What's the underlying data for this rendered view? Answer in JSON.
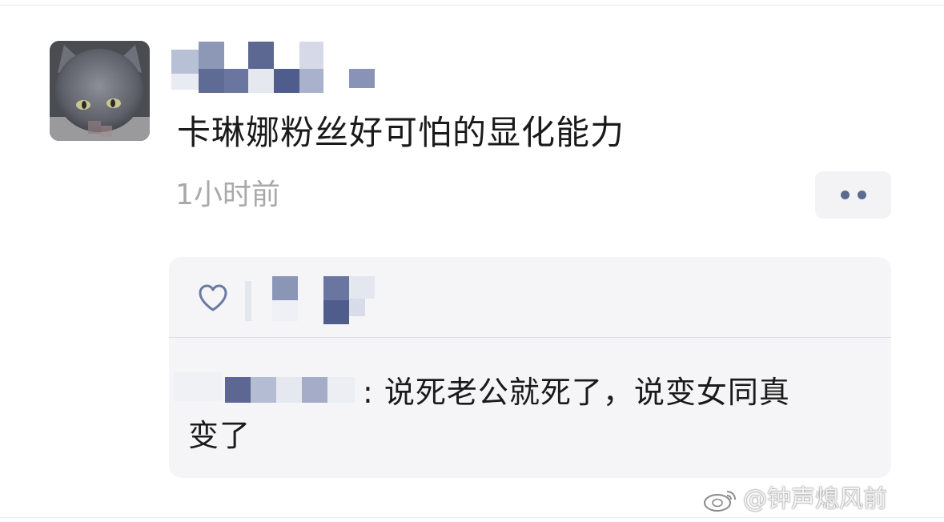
{
  "post": {
    "text": "卡琳娜粉丝好可怕的显化能力",
    "timestamp": "1小时前"
  },
  "reply": {
    "line1": ": 说死老公就死了，说变女同真",
    "line2": "变了"
  },
  "watermark": {
    "text": "@钟声熄风前"
  },
  "icons": {
    "avatar": "cat-photo",
    "more": "more-dots-icon",
    "like": "heart-icon",
    "watermark": "weibo-logo-icon"
  },
  "colors": {
    "text": "#1a1a1a",
    "timestamp": "#a9a9a9",
    "panel_bg": "#f5f5f7",
    "accent_dots": "#5b6b8f",
    "heart": "#6a7aa0"
  }
}
